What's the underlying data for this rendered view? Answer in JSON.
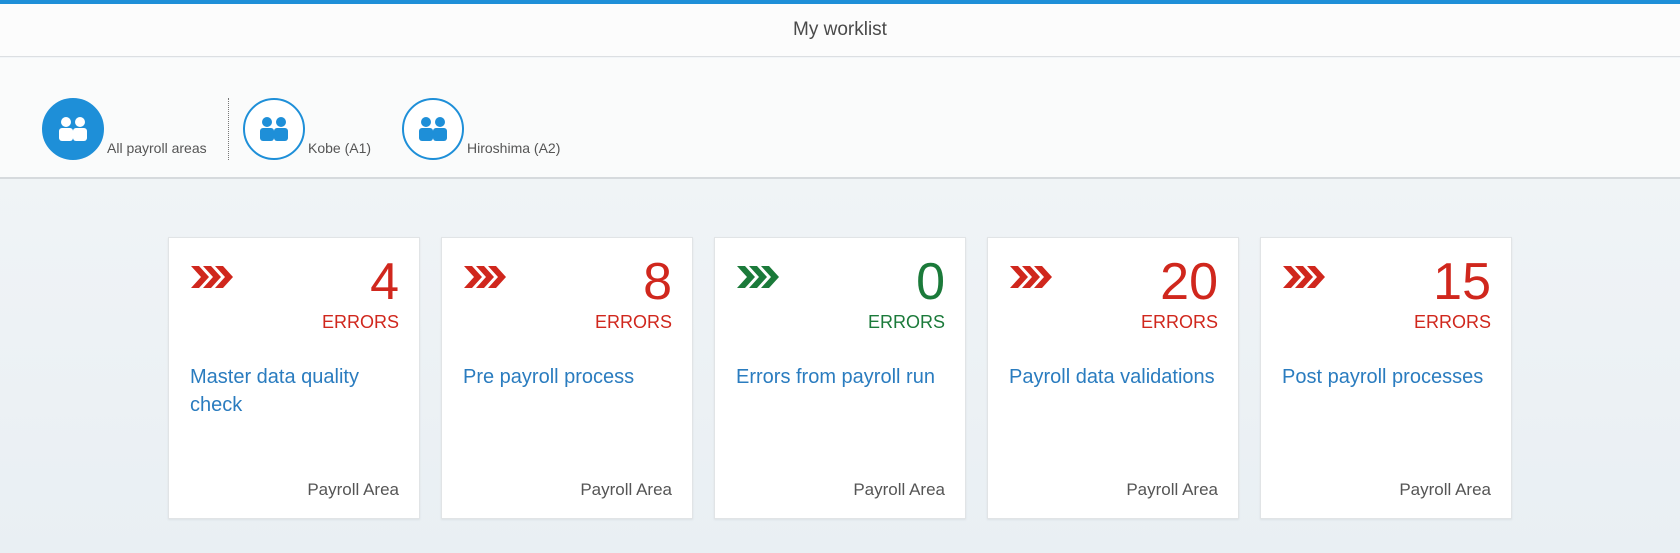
{
  "header": {
    "title": "My worklist"
  },
  "filters": [
    {
      "label": "All payroll areas",
      "selected": true,
      "icon": "group-icon"
    },
    {
      "label": "Kobe (A1)",
      "selected": false,
      "icon": "group-icon"
    },
    {
      "label": "Hiroshima (A2)",
      "selected": false,
      "icon": "group-icon"
    }
  ],
  "colors": {
    "accent": "#1e8fd8",
    "error": "#d0271d",
    "ok": "#1b7a3a",
    "link": "#2a7cbf"
  },
  "cards": [
    {
      "value": "4",
      "unit": "ERRORS",
      "title": "Master data quality check",
      "footer": "Payroll Area",
      "status": "error"
    },
    {
      "value": "8",
      "unit": "ERRORS",
      "title": "Pre payroll process",
      "footer": "Payroll Area",
      "status": "error"
    },
    {
      "value": "0",
      "unit": "ERRORS",
      "title": "Errors from payroll run",
      "footer": "Payroll Area",
      "status": "ok"
    },
    {
      "value": "20",
      "unit": "ERRORS",
      "title": "Payroll data validations",
      "footer": "Payroll Area",
      "status": "error"
    },
    {
      "value": "15",
      "unit": "ERRORS",
      "title": "Post payroll processes",
      "footer": "Payroll Area",
      "status": "error"
    }
  ]
}
